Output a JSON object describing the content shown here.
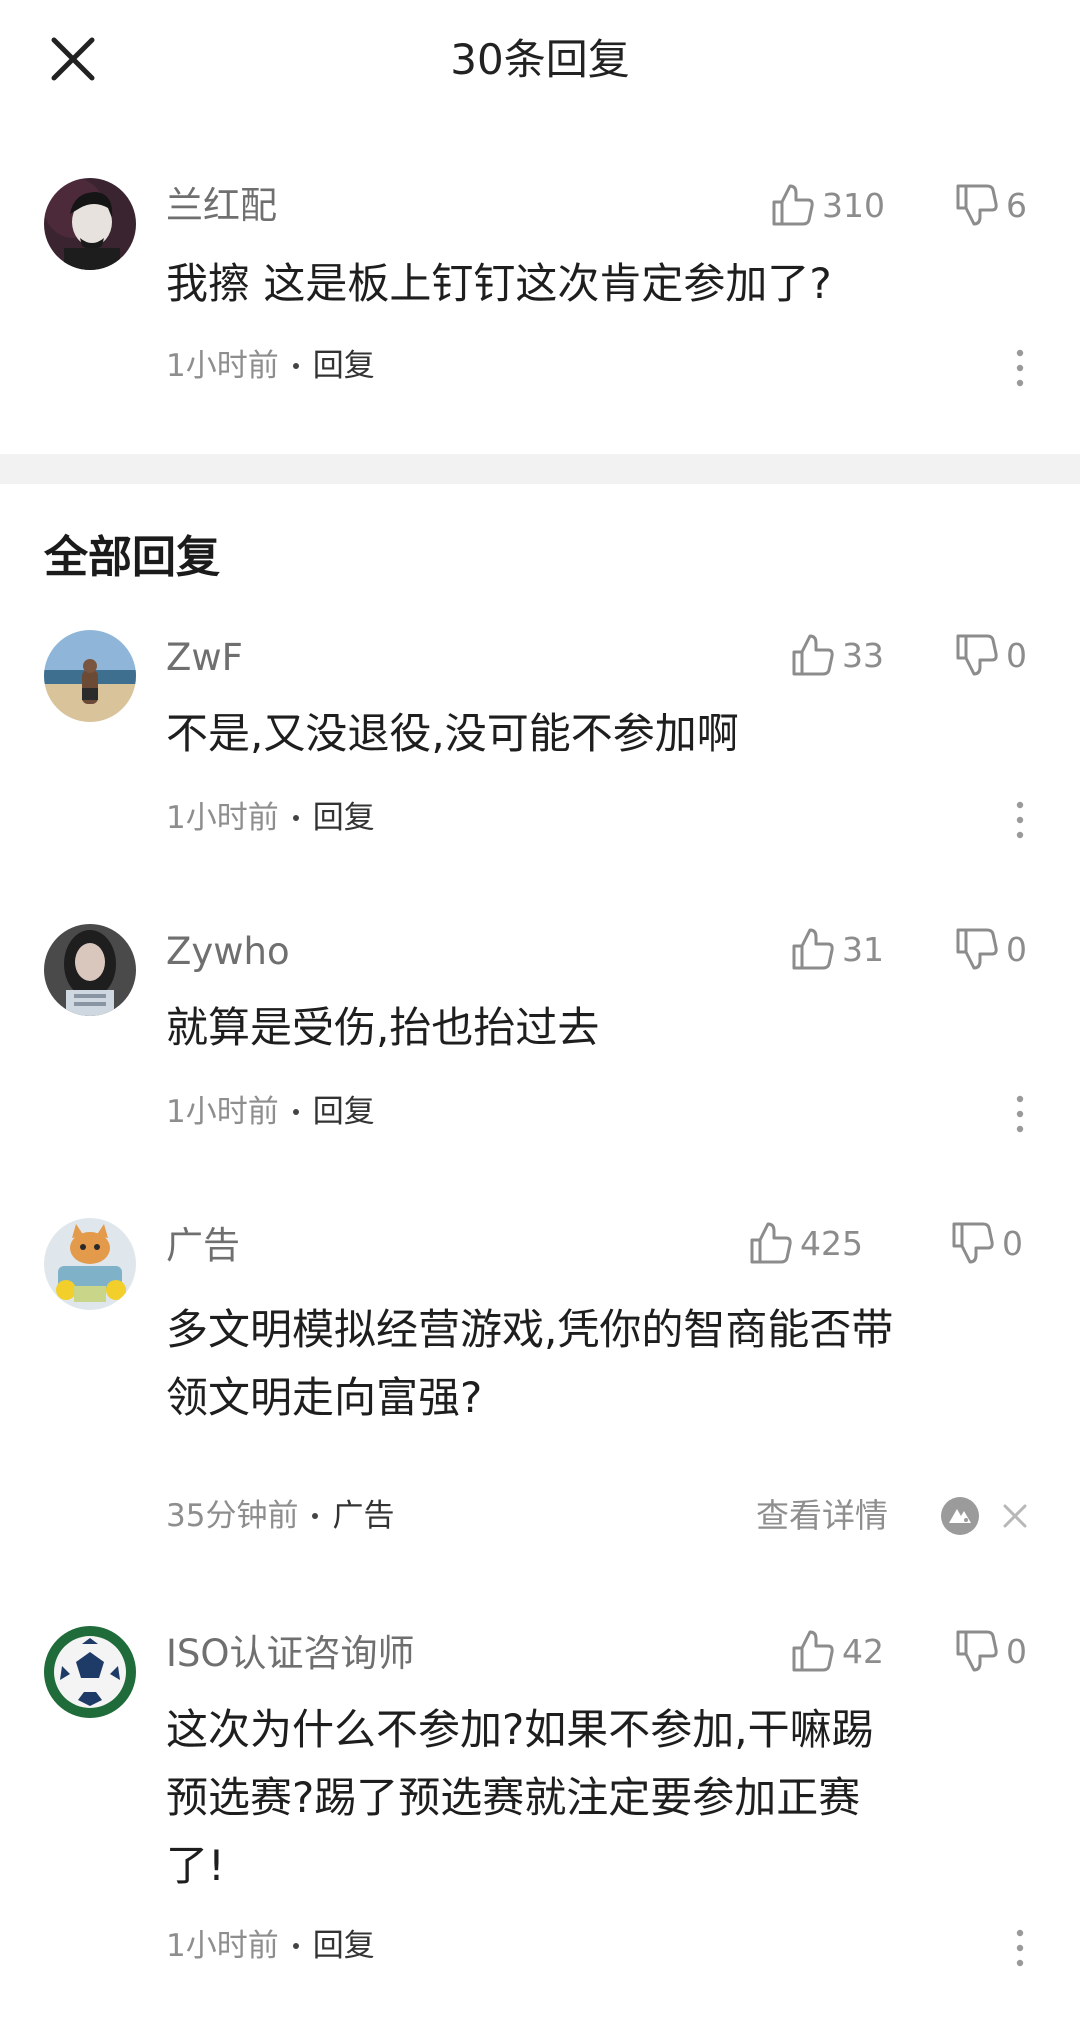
{
  "header": {
    "title": "30条回复"
  },
  "top_comment": {
    "username": "兰红配",
    "likes": "310",
    "dislikes": "6",
    "text": "我擦 这是板上钉钉这次肯定参加了?",
    "time": "1小时前",
    "reply_label": "回复"
  },
  "section": {
    "title": "全部回复"
  },
  "replies": [
    {
      "username": "ZwF",
      "likes": "33",
      "dislikes": "0",
      "text": "不是,又没退役,没可能不参加啊",
      "time": "1小时前",
      "reply_label": "回复"
    },
    {
      "username": "Zywho",
      "likes": "31",
      "dislikes": "0",
      "text": "就算是受伤,抬也抬过去",
      "time": "1小时前",
      "reply_label": "回复"
    },
    {
      "username": "广告",
      "likes": "425",
      "dislikes": "0",
      "text_line1": "多文明模拟经营游戏,凭你的智商能否带",
      "text_line2": "领文明走向富强?",
      "time": "35分钟前",
      "tag_label": "广告",
      "detail_label": "查看详情"
    },
    {
      "username": "ISO认证咨询师",
      "likes": "42",
      "dislikes": "0",
      "text_line1": "这次为什么不参加?如果不参加,干嘛踢",
      "text_line2": "预选赛?踢了预选赛就注定要参加正赛",
      "text_line3": "了!",
      "time": "1小时前",
      "reply_label": "回复"
    }
  ],
  "colors": {
    "text_primary": "#1e1e1e",
    "text_secondary": "#8e8e8e",
    "divider": "#f2f2f2"
  },
  "icons": [
    "close-icon",
    "thumbs-up-icon",
    "thumbs-down-icon",
    "more-vertical-icon",
    "ad-platform-logo-icon",
    "dismiss-icon"
  ]
}
